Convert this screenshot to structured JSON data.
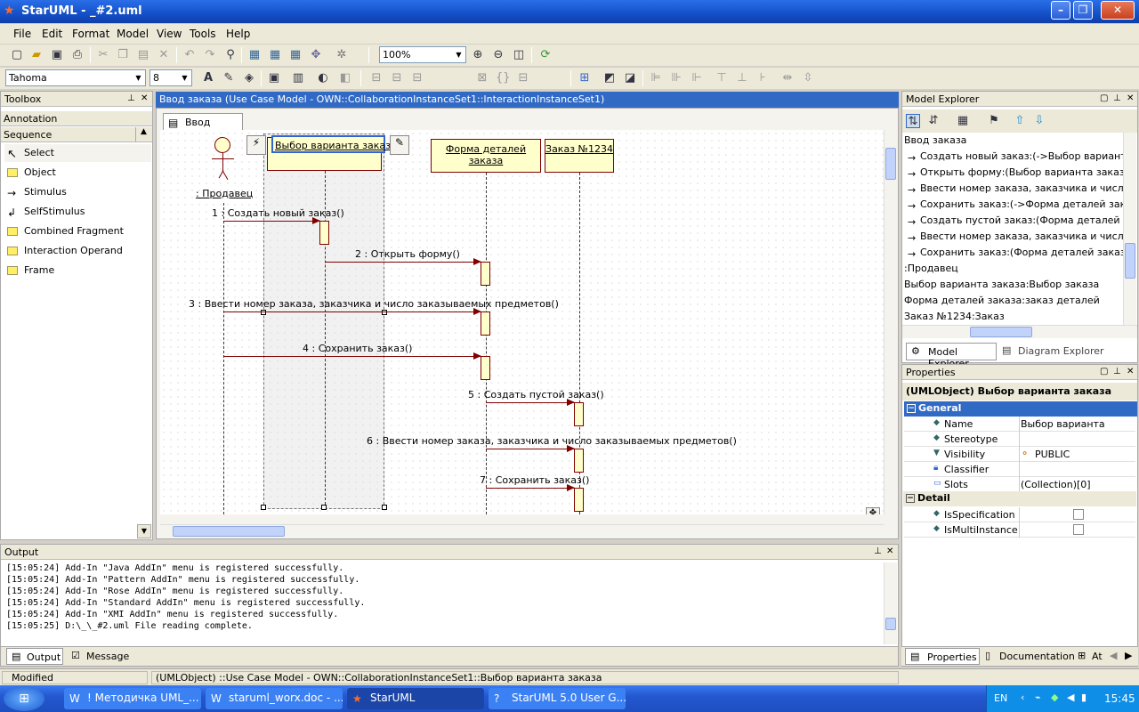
{
  "window": {
    "title": "StarUML - _#2.uml"
  },
  "menu": [
    "File",
    "Edit",
    "Format",
    "Model",
    "View",
    "Tools",
    "Help"
  ],
  "toolbar": {
    "zoom": "100%",
    "font": "Tahoma",
    "font_size": "8"
  },
  "toolbox": {
    "title": "Toolbox",
    "annotation": "Annotation",
    "sequence": "Sequence",
    "items": [
      "Select",
      "Object",
      "Stimulus",
      "SelfStimulus",
      "Combined Fragment",
      "Interaction Operand",
      "Frame"
    ]
  },
  "doc": {
    "path": "Ввод заказа (Use Case Model - OWN::CollaborationInstanceSet1::InteractionInstanceSet1)",
    "tab": "Ввод заказа"
  },
  "diagram": {
    "actor": ": Продавец",
    "objects": [
      "Выбор варианта заказа",
      "Форма деталей заказа",
      "Заказ №1234"
    ],
    "messages": [
      "1 : Создать новый заказ()",
      "2 : Открыть форму()",
      "3 : Ввести номер заказа, заказчика и число заказываемых предметов()",
      "4 : Сохранить заказ()",
      "5 : Создать пустой заказ()",
      "6 : Ввести номер заказа, заказчика и число заказываемых предметов()",
      "7 : Сохранить заказ()"
    ]
  },
  "explorer": {
    "title": "Model Explorer",
    "items": [
      "Ввод заказа",
      "Создать новый заказ:(->Выбор варианта зака",
      "Открыть форму:(Выбор варианта заказа->Ф",
      "Ввести номер заказа, заказчика и число зак",
      "Сохранить заказ:(->Форма деталей заказа)",
      "Создать пустой заказ:(Форма деталей заказ",
      "Ввести номер заказа, заказчика и число зак",
      "Сохранить заказ:(Форма деталей заказа->З",
      ":Продавец",
      "Выбор варианта заказа:Выбор заказа",
      "Форма деталей заказа:заказ деталей",
      "Заказ №1234:Заказ"
    ],
    "tabs": [
      "Model Explorer",
      "Diagram Explorer"
    ]
  },
  "properties": {
    "title": "Properties",
    "object": "(UMLObject) Выбор варианта заказа",
    "general": "General",
    "detail": "Detail",
    "rows": [
      {
        "k": "Name",
        "v": "Выбор варианта заказа"
      },
      {
        "k": "Stereotype",
        "v": ""
      },
      {
        "k": "Visibility",
        "v": "PUBLIC"
      },
      {
        "k": "Classifier",
        "v": ""
      },
      {
        "k": "Slots",
        "v": "(Collection)[0]"
      }
    ],
    "detail_rows": [
      {
        "k": "IsSpecification"
      },
      {
        "k": "IsMultiInstance"
      }
    ],
    "tabs": [
      "Properties",
      "Documentation",
      "At"
    ]
  },
  "output": {
    "title": "Output",
    "lines": [
      "[15:05:24]  Add-In \"Java AddIn\" menu is registered successfully.",
      "[15:05:24]  Add-In \"Pattern AddIn\" menu is registered successfully.",
      "[15:05:24]  Add-In \"Rose AddIn\" menu is registered successfully.",
      "[15:05:24]  Add-In \"Standard AddIn\" menu is registered successfully.",
      "[15:05:24]  Add-In \"XMI AddIn\" menu is registered successfully.",
      "[15:05:25]  D:\\_\\_#2.uml File reading complete."
    ],
    "tabs": [
      "Output",
      "Message"
    ]
  },
  "status": {
    "mode": "Modified",
    "text": "(UMLObject) ::Use Case Model - OWN::CollaborationInstanceSet1::Выбор варианта заказа"
  },
  "taskbar": {
    "items": [
      "! Методичка UML_...",
      "staruml_worx.doc - ...",
      "StarUML",
      "StarUML 5.0 User G..."
    ],
    "lang": "EN",
    "time": "15:45"
  }
}
